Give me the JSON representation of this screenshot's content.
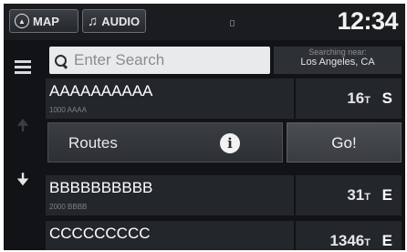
{
  "topbar": {
    "map_label": "MAP",
    "audio_label": "AUDIO",
    "clock": "12:34"
  },
  "search": {
    "placeholder": "Enter Search",
    "value": ""
  },
  "near": {
    "label": "Searching near:",
    "city": "Los Angeles, CA"
  },
  "actions": {
    "routes_label": "Routes",
    "go_label": "Go!"
  },
  "results": [
    {
      "name": "AAAAAAAAAA",
      "address": "1000 AAAA",
      "distance": "16",
      "unit": "T",
      "direction": "S"
    },
    {
      "name": "BBBBBBBBBB",
      "address": "2000 BBBB",
      "distance": "31",
      "unit": "T",
      "direction": "E"
    },
    {
      "name": "CCCCCCCCC",
      "address": "",
      "distance": "1346",
      "unit": "T",
      "direction": "E"
    }
  ],
  "icons": {
    "map": "compass-icon",
    "audio": "music-note-icon",
    "menu": "menu-icon",
    "search": "search-icon",
    "info": "info-icon",
    "scroll_up": "arrow-up-icon",
    "scroll_down": "arrow-down-icon"
  },
  "colors": {
    "background": "#111316",
    "row": "#23262a",
    "search_field": "#e9eaec"
  }
}
